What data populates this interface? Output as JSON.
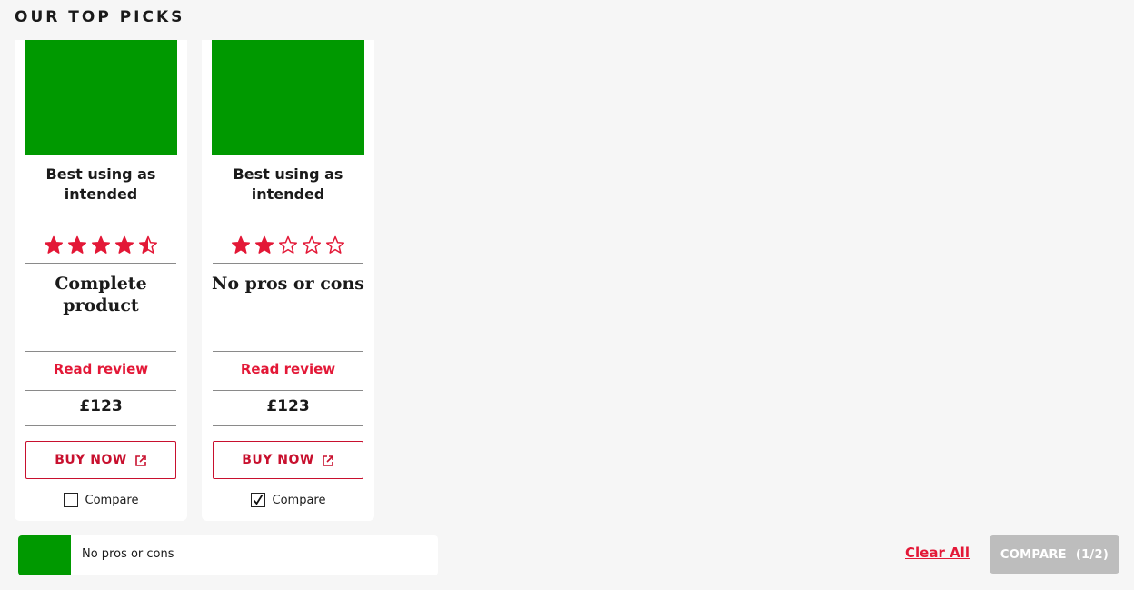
{
  "heading": "OUR TOP PICKS",
  "colors": {
    "accent": "#e31837",
    "product_image": "#009900",
    "compare_button_disabled": "#bdbdbd"
  },
  "cards": [
    {
      "title": "Best using as intended",
      "rating": 4.5,
      "rating_max": 5,
      "summary": "Complete product",
      "read_review": "Read review",
      "price": "£123",
      "buy_label": "BUY NOW",
      "buy_icon": "external-link-icon",
      "compare_label": "Compare",
      "compare_checked": false
    },
    {
      "title": "Best using as intended",
      "rating": 2,
      "rating_max": 5,
      "summary": "No pros or cons",
      "read_review": "Read review",
      "price": "£123",
      "buy_label": "BUY NOW",
      "buy_icon": "external-link-icon",
      "compare_label": "Compare",
      "compare_checked": true
    }
  ],
  "compare_bar": {
    "item_label": "No pros or cons",
    "clear_all": "Clear All",
    "compare_label": "COMPARE",
    "compare_count": "(1/2)"
  }
}
